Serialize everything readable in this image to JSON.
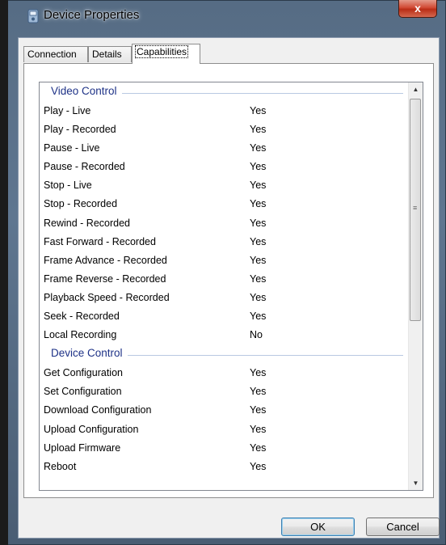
{
  "window": {
    "title": "Device Properties",
    "close_glyph": "x"
  },
  "tabs": [
    {
      "label": "Connection",
      "active": false
    },
    {
      "label": "Details",
      "active": false
    },
    {
      "label": "Capabilities",
      "active": true
    }
  ],
  "groups": [
    {
      "title": "Video Control",
      "rows": [
        {
          "name": "Play - Live",
          "value": "Yes"
        },
        {
          "name": "Play - Recorded",
          "value": "Yes"
        },
        {
          "name": "Pause - Live",
          "value": "Yes"
        },
        {
          "name": "Pause - Recorded",
          "value": "Yes"
        },
        {
          "name": "Stop - Live",
          "value": "Yes"
        },
        {
          "name": "Stop - Recorded",
          "value": "Yes"
        },
        {
          "name": "Rewind - Recorded",
          "value": "Yes"
        },
        {
          "name": "Fast Forward - Recorded",
          "value": "Yes"
        },
        {
          "name": "Frame Advance - Recorded",
          "value": "Yes"
        },
        {
          "name": "Frame Reverse - Recorded",
          "value": "Yes"
        },
        {
          "name": "Playback Speed - Recorded",
          "value": "Yes"
        },
        {
          "name": "Seek - Recorded",
          "value": "Yes"
        },
        {
          "name": "Local Recording",
          "value": "No"
        }
      ]
    },
    {
      "title": "Device Control",
      "rows": [
        {
          "name": "Get Configuration",
          "value": "Yes"
        },
        {
          "name": "Set Configuration",
          "value": "Yes"
        },
        {
          "name": "Download Configuration",
          "value": "Yes"
        },
        {
          "name": "Upload Configuration",
          "value": "Yes"
        },
        {
          "name": "Upload Firmware",
          "value": "Yes"
        },
        {
          "name": "Reboot",
          "value": "Yes"
        }
      ]
    }
  ],
  "scrollbar": {
    "up_glyph": "▲",
    "down_glyph": "▼",
    "grip_glyph": "≡"
  },
  "buttons": {
    "ok": "OK",
    "cancel": "Cancel"
  },
  "colors": {
    "group_title": "#1e3287",
    "close_button": "#c8432c",
    "frame": "#5f7690"
  }
}
